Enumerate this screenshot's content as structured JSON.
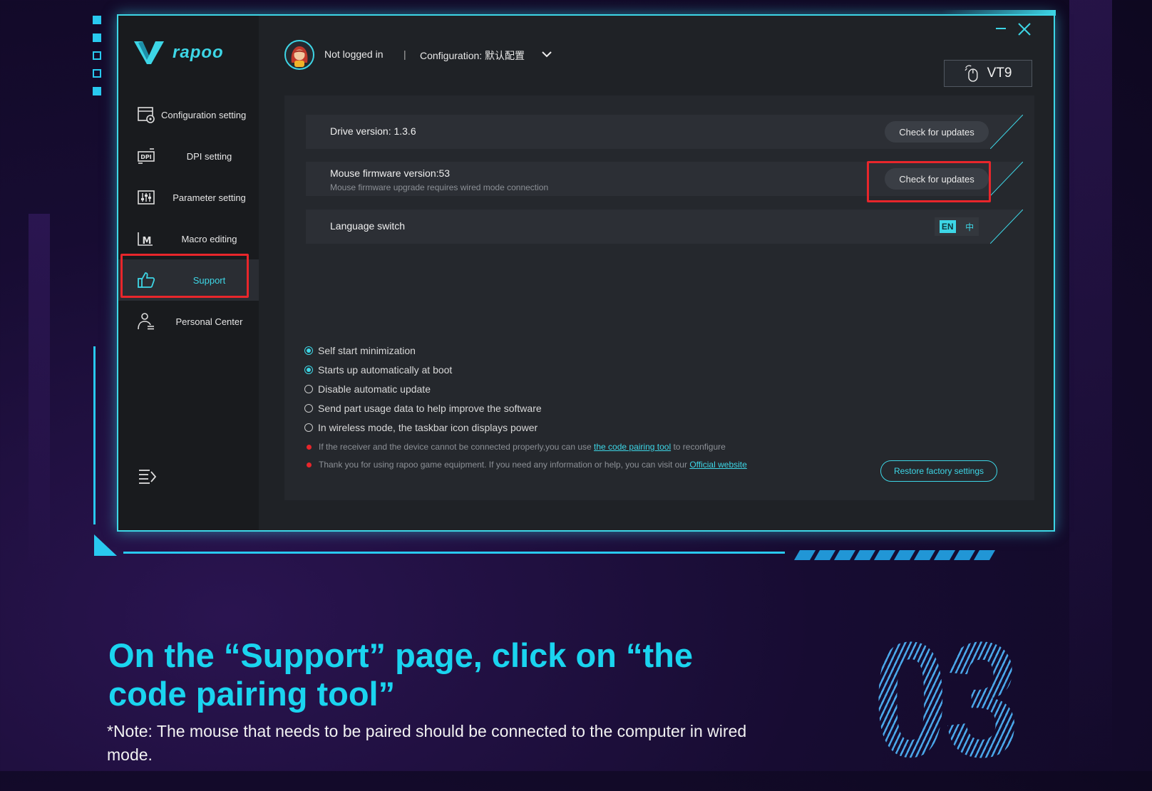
{
  "app": {
    "brand": "rapoo",
    "user_status": "Not logged in",
    "separator": "|",
    "configuration": "Configuration: 默认配置",
    "device": "VT9"
  },
  "sidebar": {
    "items": [
      {
        "label": "Configuration setting"
      },
      {
        "label": "DPI setting"
      },
      {
        "label": "Parameter setting"
      },
      {
        "label": "Macro editing"
      },
      {
        "label": "Support"
      },
      {
        "label": "Personal Center"
      }
    ]
  },
  "support": {
    "drive_version": "Drive version: 1.3.6",
    "check_updates_label": "Check for updates",
    "firmware_version": "Mouse firmware version:53",
    "firmware_note": "Mouse firmware upgrade requires wired mode connection",
    "language_label": "Language switch",
    "lang_en": "EN",
    "lang_zh": "中",
    "options": [
      {
        "label": "Self start minimization",
        "checked": true
      },
      {
        "label": "Starts up automatically at boot",
        "checked": true
      },
      {
        "label": "Disable automatic update",
        "checked": false
      },
      {
        "label": "Send part usage data to help improve the software",
        "checked": false
      },
      {
        "label": "In wireless mode, the taskbar icon displays power",
        "checked": false
      }
    ],
    "note1_before": "If the receiver and the device cannot be connected properly,you can use ",
    "note1_link": "the code pairing tool",
    "note1_after": " to reconfigure",
    "note2_before": "Thank you for using rapoo game equipment. If you need any information or help, you can visit our ",
    "note2_link": "Official website",
    "restore_label": "Restore factory settings"
  },
  "caption": {
    "title": "On the “Support” page, click on “the code pairing tool”",
    "note": "*Note: The mouse that needs to be paired should be connected to the computer in wired mode.",
    "step_number": "03"
  },
  "colors": {
    "accent": "#3dd6e6",
    "highlight": "#e8262b",
    "caption_blue": "#1ad4ef"
  }
}
